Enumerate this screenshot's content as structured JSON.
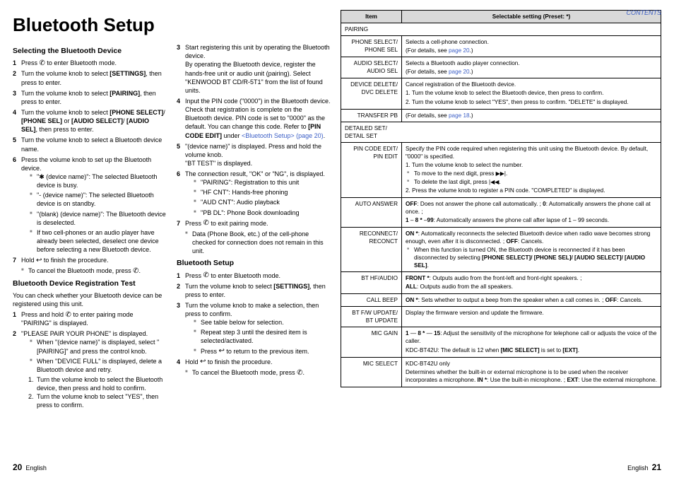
{
  "header": {
    "contents": "CONTENTS"
  },
  "title": "Bluetooth Setup",
  "left": {
    "col1": {
      "h_select": "Selecting the Bluetooth Device",
      "s1": "Press  to enter Bluetooth mode.",
      "s2a": "Turn the volume knob to select ",
      "s2b": "[SETTINGS]",
      "s2c": ", then press to enter.",
      "s3a": "Turn the volume knob to select ",
      "s3b": "[PAIRING]",
      "s3c": ", then press to enter.",
      "s4a": "Turn the volume knob to select ",
      "s4b": "[PHONE SELECT]",
      "s4c": "/ ",
      "s4d": "[PHONE SEL]",
      "s4e": " or ",
      "s4f": "[AUDIO SELECT]",
      "s4g": "/ ",
      "s4h": "[AUDIO SEL]",
      "s4i": ", then press to enter.",
      "s5": "Turn the volume knob to select a Bluetooth device name.",
      "s6": "Press the volume knob to set up the Bluetooth device.",
      "b6a": "\"✱ (device name)\": The selected Bluetooth device is busy.",
      "b6b": "\"- (device name)\": The selected Bluetooth device is on standby.",
      "b6c": "\"(blank) (device name)\": The Bluetooth device is deselected.",
      "b6d": "If two cell-phones or an audio player have already been selected, deselect one device before selecting a new Bluetooth device.",
      "s7a": "Hold ",
      "s7b": " to finish the procedure.",
      "b7": "To cancel the Bluetooth mode, press ",
      "h_test": "Bluetooth Device Registration Test",
      "test_intro": "You can check whether your Bluetooth device can be registered using this unit.",
      "t1a": "Press and hold ",
      "t1b": " to enter pairing mode",
      "t1c": "\"PAIRING\" is displayed.",
      "t2": "\"PLEASE PAIR YOUR PHONE\" is displayed.",
      "t2b1": "When \"(device name)\" is displayed, select \"[PAIRING]\" and press the control knob.",
      "t2b2": "When \"DEVICE FULL\" is displayed, delete a Bluetooth device and retry.",
      "t2n1": "Turn the volume knob to select the Bluetooth device, then press and hold to confirm.",
      "t2n2": "Turn the volume knob to select \"YES\", then press to confirm."
    },
    "col2": {
      "s3": "Start registering this unit by operating the Bluetooth device.",
      "s3desc": "By operating the Bluetooth device, register the hands-free unit or audio unit (pairing). Select \"KENWOOD BT CD/R-5T1\" from the list of found units.",
      "s4": "Input the PIN code (\"0000\") in the Bluetooth device.",
      "s4desc1": "Check that registration is complete on the Bluetooth device. PIN code is set to \"0000\" as the default. You can change this code. Refer to ",
      "s4desc2": "[PIN CODE EDIT]",
      "s4desc3": " under ",
      "s4link": "<Bluetooth Setup> (page 20)",
      "s5": "\"(device name)\" is displayed. Press and hold the volume knob.",
      "s5desc": "\"BT TEST\" is displayed.",
      "s6": "The connection result, \"OK\" or \"NG\", is displayed.",
      "b6a": "\"PAIRING\": Registration to this unit",
      "b6b": "\"HF CNT\": Hands-free phoning",
      "b6c": "\"AUD CNT\": Audio playback",
      "b6d": "\"PB DL\": Phone Book downloading",
      "s7a": "Press ",
      "s7b": " to exit pairing mode.",
      "b7": "Data (Phone Book, etc.) of the cell-phone checked for connection does not remain in this unit.",
      "h_setup": "Bluetooth Setup",
      "bs1": "Press  to enter Bluetooth mode.",
      "bs2a": "Turn the volume knob to select ",
      "bs2b": "[SETTINGS]",
      "bs2c": ", then press to enter.",
      "bs3": "Turn the volume knob to make a selection, then press to confirm.",
      "bs3b1": "See table below for selection.",
      "bs3b2": "Repeat step 3 until the desired item is selected/activated.",
      "bs3b3a": "Press ",
      "bs3b3b": " to return to the previous item.",
      "bs4a": "Hold ",
      "bs4b": " to finish the procedure.",
      "bs4note": "To cancel the Bluetooth mode, press "
    }
  },
  "table": {
    "th_item": "Item",
    "th_setting": "Selectable setting (Preset: *)",
    "rows": {
      "pairing": "PAIRING",
      "phone_sel_item": "PHONE SELECT/\nPHONE SEL",
      "phone_sel_val": "Selects a cell-phone connection.",
      "phone_sel_val2": "(For details, see ",
      "page20": "page 20",
      "audio_sel_item": "AUDIO SELECT/\nAUDIO SEL",
      "audio_sel_val": "Selects a Bluetooth audio player connection.",
      "dev_del_item": "DEVICE DELETE/\nDVC DELETE",
      "dev_del_val1": "Cancel registration of the Bluetooth device.",
      "dev_del_val2": "1. Turn the volume knob to select the Bluetooth device, then press to confirm.",
      "dev_del_val3": "2. Turn the volume knob to select \"YES\", then press to confirm. \"DELETE\" is displayed.",
      "transfer_item": "TRANSFER PB",
      "transfer_val": "(For details, see ",
      "page18": "page 18",
      "detailed": "DETAILED SET/\nDETAIL SET",
      "pin_item": "PIN CODE EDIT/\nPIN EDIT",
      "pin_val1": "Specify the PIN code required when registering this unit using the Bluetooth device. By default, \"0000\" is specified.",
      "pin_val2": "1. Turn the volume knob to select the number.",
      "pin_val3": "To move to the next digit, press ",
      "pin_val4": "To delete the last digit, press ",
      "pin_val5": "2. Press the volume knob to register a PIN code. \"COMPLETED\" is displayed.",
      "auto_item": "AUTO ANSWER",
      "auto_off": "OFF",
      "auto_val1": ": Does not answer the phone call automatically. ; ",
      "auto_0": "0",
      "auto_val2": ": Automatically answers the phone call at once. ;",
      "auto_1": "1",
      "auto_dash": " – ",
      "auto_8": "8 *",
      "auto_99": "99",
      "auto_val3": ": Automatically answers the phone call after lapse of 1 – 99 seconds.",
      "recon_item": "RECONNECT/\nRECONCT",
      "recon_on": "ON *",
      "recon_val1": ": Automatically reconnects the selected Bluetooth device when radio wave becomes strong enough, even after it is disconnected. ; ",
      "recon_off": "OFF",
      "recon_val2": ": Cancels.",
      "recon_val3": "When this function is turned ON, the Bluetooth device is reconnected if it has been disconnected by selecting ",
      "recon_bold": "[PHONE SELECT]/ [PHONE SEL]/ [AUDIO SELECT]/ [AUDIO SEL]",
      "bthf_item": "BT HF/AUDIO",
      "bthf_front": "FRONT *",
      "bthf_val1": ": Outputs audio from the front-left and front-right speakers. ;",
      "bthf_all": "ALL",
      "bthf_val2": ": Outputs audio from the all speakers.",
      "beep_item": "CALL BEEP",
      "beep_on": "ON *",
      "beep_val1": ": Sets whether to output a beep from the speaker when a call comes in. ; ",
      "beep_off": "OFF",
      "beep_val2": ": Cancels.",
      "fw_item": "BT F/W UPDATE/\nBT UPDATE",
      "fw_val": "Display the firmware version and update the firmware.",
      "mic_item": "MIC GAIN",
      "mic_1": "1",
      "mic_8": "8 *",
      "mic_15": "15",
      "mic_val1": ": Adjust the sensitivity of the microphone for telephone call or adjusts the voice of the caller.",
      "mic_val2": "KDC-BT42U: The default is 12 when ",
      "mic_bold": "[MIC SELECT]",
      "mic_val3": " is set to ",
      "mic_ext": "[EXT]",
      "msel_item": "MIC SELECT",
      "msel_val1": "KDC-BT42U only",
      "msel_val2": "Determines whether the built-in or external microphone is to be used when the receiver incorporates a microphone. ",
      "msel_in": "IN *",
      "msel_val3": ": Use the built-in microphone. ; ",
      "msel_ext": "EXT",
      "msel_val4": ": Use the external microphone."
    }
  },
  "footer": {
    "left_page": "20",
    "right_page": "21",
    "lang": "English"
  }
}
